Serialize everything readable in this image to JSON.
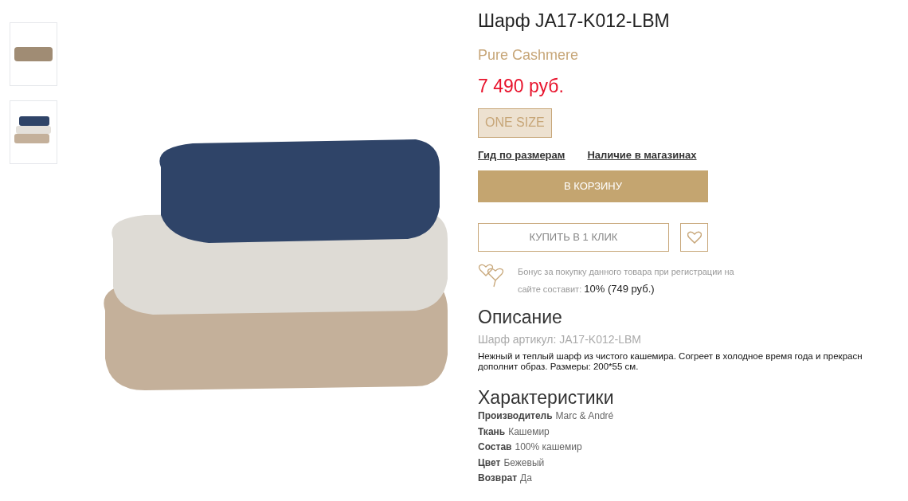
{
  "gallery": {
    "thumbnails": [
      {
        "kind": "single"
      },
      {
        "kind": "stack"
      }
    ]
  },
  "product": {
    "title": "Шарф JA17-K012-LBM",
    "brand": "Pure Cashmere",
    "price": "7 490 руб.",
    "sizes": [
      {
        "label": "ONE SIZE",
        "selected": true
      }
    ],
    "links": [
      "Гид по размерам",
      "Наличие в магазинах"
    ],
    "cart_button": "В КОРЗИНУ",
    "one_click_button": "КУПИТЬ В 1 КЛИК",
    "bonus": {
      "text": "Бонус за покупку данного товара при регистрации на сайте составит:",
      "value": "10% (749 руб.)"
    }
  },
  "description": {
    "heading": "Описание",
    "article": "Шарф артикул: JA17-K012-LBM",
    "lines": [
      "Нежный и теплый шарф из чистого кашемира. Согреет в холодное время года и прекрасн",
      "дополнит образ. Размеры: 200*55 см."
    ]
  },
  "specs": {
    "heading": "Характеристики",
    "rows": [
      {
        "label": "Производитель",
        "value": "Marc & André"
      },
      {
        "label": "Ткань",
        "value": "Кашемир"
      },
      {
        "label": "Состав",
        "value": "100% кашемир"
      },
      {
        "label": "Цвет",
        "value": "Бежевый"
      },
      {
        "label": "Возврат",
        "value": "Да"
      }
    ]
  }
}
